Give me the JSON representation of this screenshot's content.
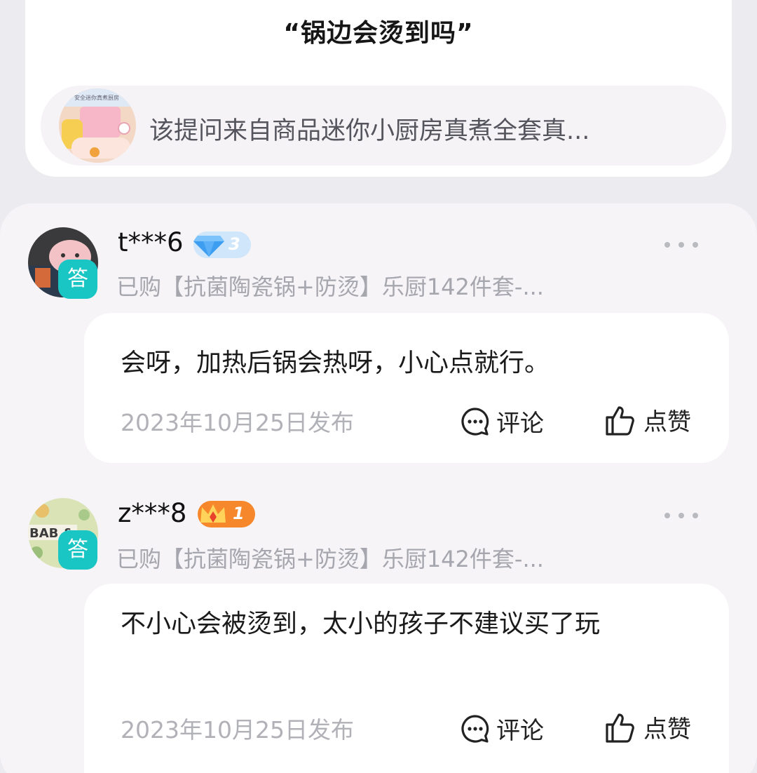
{
  "question": {
    "title": "“锅边会烫到吗”",
    "source_text": "该提问来自商品迷你小厨房真煮全套真...",
    "thumbnail_caption": "安全迷你真煮厨房"
  },
  "answers": [
    {
      "username": "t***6",
      "level_badge": {
        "icon": "diamond-icon",
        "level": "3",
        "color": "#4aa8f0"
      },
      "answer_badge": "答",
      "purchased": "已购【抗菌陶瓷锅+防烫】乐厨142件套-...",
      "text": "会呀，加热后锅会热呀，小心点就行。",
      "date": "2023年10月25日发布",
      "comment_label": "评论",
      "like_label": "点赞"
    },
    {
      "username": "z***8",
      "level_badge": {
        "icon": "crown-icon",
        "level": "1",
        "color": "#f6872a"
      },
      "answer_badge": "答",
      "purchased": "已购【抗菌陶瓷锅+防烫】乐厨142件套-...",
      "text": "不小心会被烫到，太小的孩子不建议买了玩",
      "date": "2023年10月25日发布",
      "comment_label": "评论",
      "like_label": "点赞",
      "avatar_text": "BAB &"
    }
  ],
  "colors": {
    "answer_badge": "#19c6c4",
    "secondary_text": "#a6a6ae",
    "panel_background": "#f6f4f7"
  }
}
